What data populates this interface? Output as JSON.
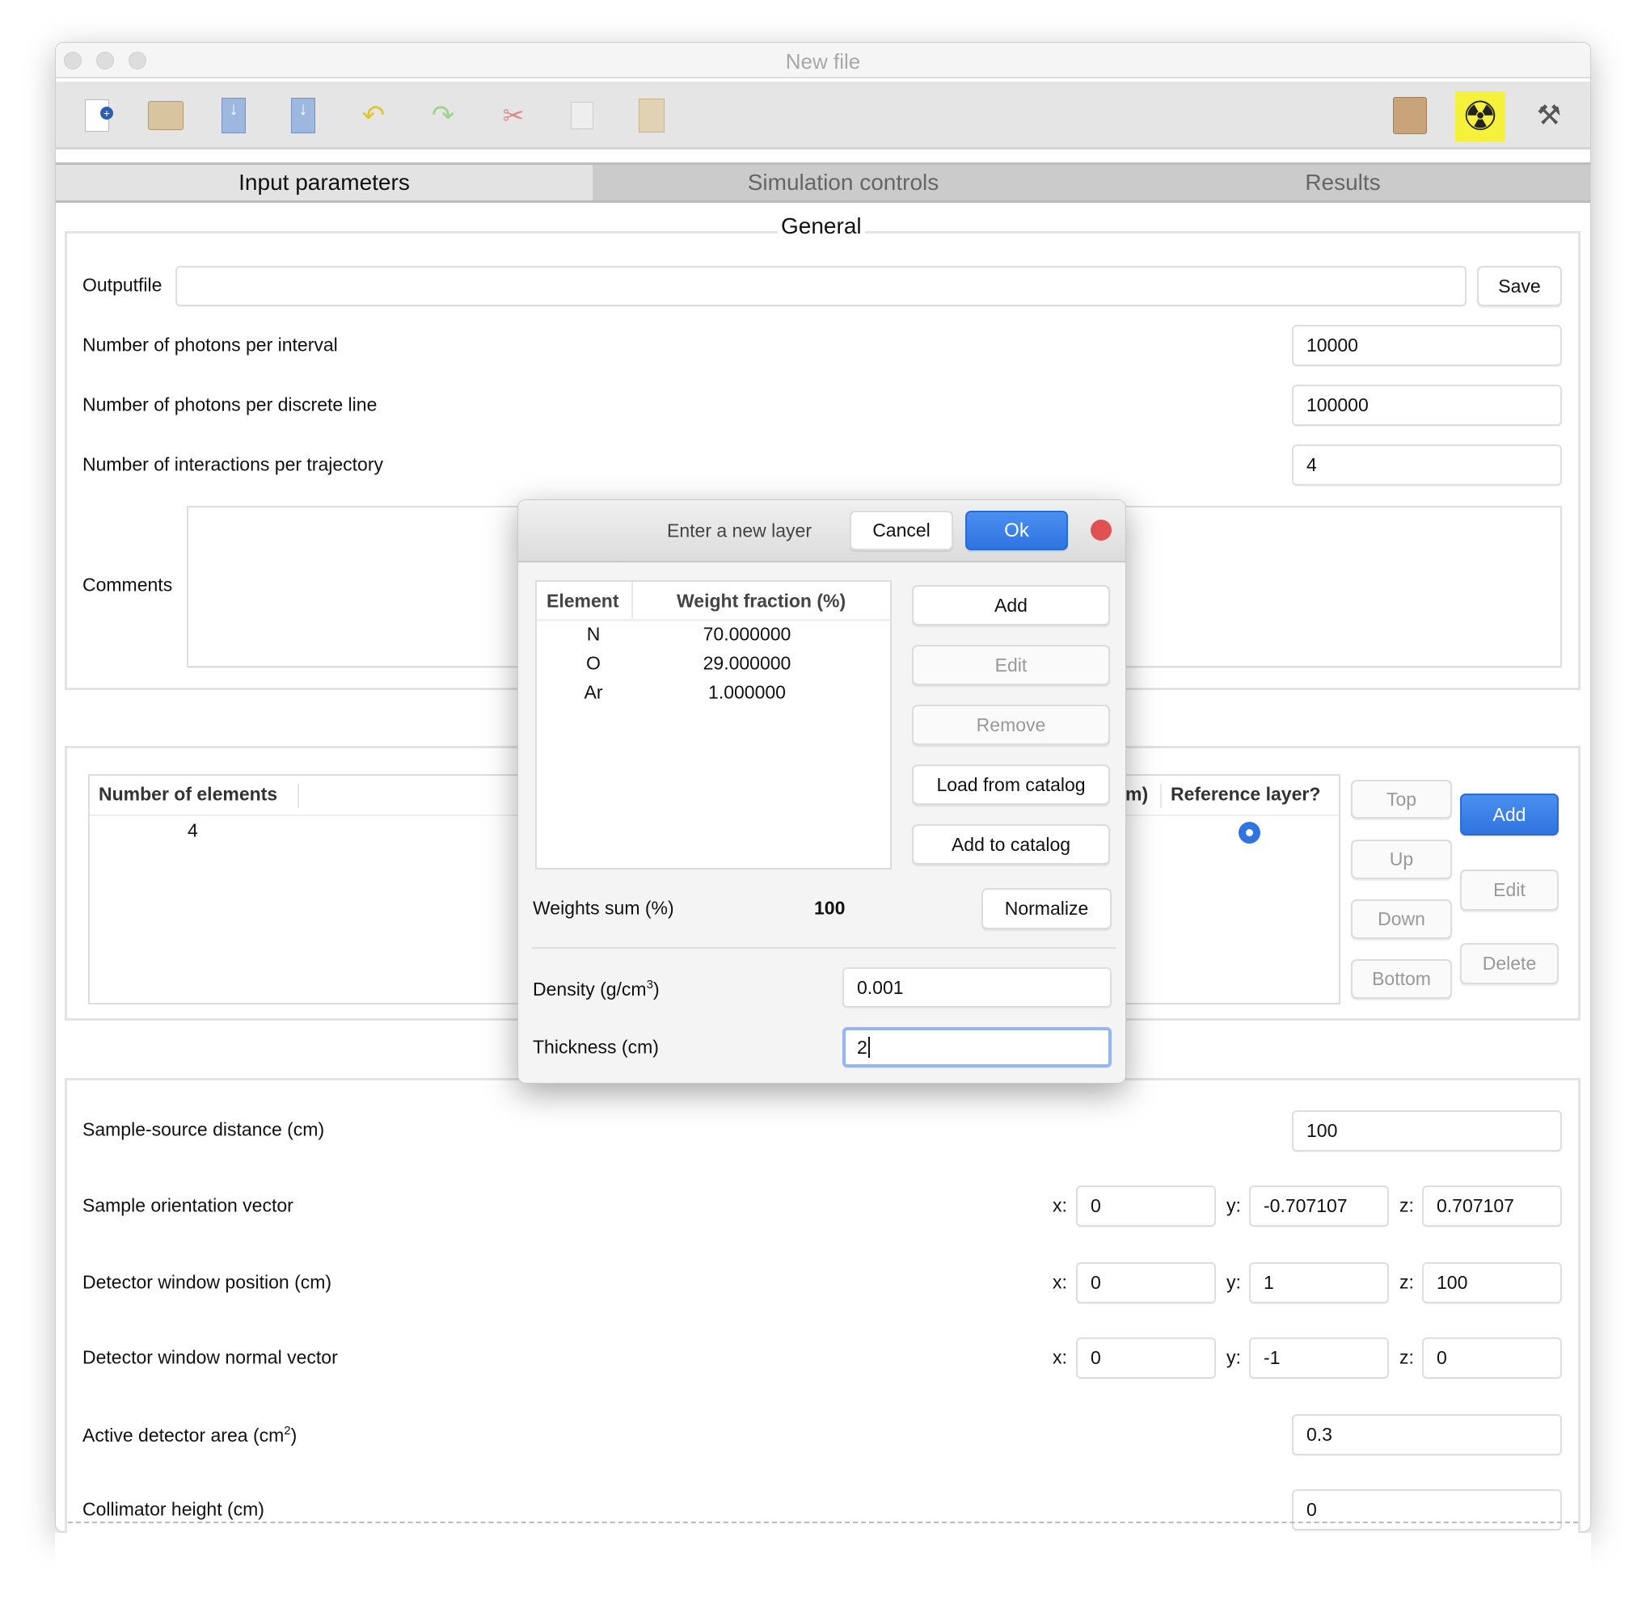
{
  "window": {
    "title": "New file"
  },
  "toolbar": {
    "icons": [
      "new-file-icon",
      "open-folder-icon",
      "save-icon",
      "save-as-icon",
      "undo-icon",
      "redo-icon",
      "cut-icon",
      "copy-icon",
      "paste-icon",
      "package-icon",
      "radiation-icon",
      "tools-icon"
    ]
  },
  "tabs": [
    {
      "label": "Input parameters",
      "active": true
    },
    {
      "label": "Simulation controls",
      "active": false
    },
    {
      "label": "Results",
      "active": false
    }
  ],
  "general": {
    "title": "General",
    "outputfile_label": "Outputfile",
    "outputfile_value": "",
    "save_label": "Save",
    "photons_interval_label": "Number of photons per interval",
    "photons_interval_value": "10000",
    "photons_line_label": "Number of photons per discrete line",
    "photons_line_value": "100000",
    "interactions_label": "Number of interactions per trajectory",
    "interactions_value": "4",
    "comments_label": "Comments",
    "comments_value": ""
  },
  "layers": {
    "columns": {
      "number_of_elements": "Number of elements",
      "thickness_partial": "m)",
      "reference": "Reference layer?"
    },
    "rows": [
      {
        "number_of_elements": "4",
        "reference": true
      }
    ],
    "buttons": {
      "top": "Top",
      "up": "Up",
      "down": "Down",
      "bottom": "Bottom",
      "add": "Add",
      "edit": "Edit",
      "delete": "Delete"
    }
  },
  "geometry": {
    "distance_label": "Sample-source distance (cm)",
    "distance_value": "100",
    "orientation_label": "Sample orientation vector",
    "orientation": {
      "x": "0",
      "y": "-0.707107",
      "z": "0.707107"
    },
    "det_pos_label": "Detector window position (cm)",
    "det_pos": {
      "x": "0",
      "y": "1",
      "z": "100"
    },
    "det_normal_label": "Detector window normal vector",
    "det_normal": {
      "x": "0",
      "y": "-1",
      "z": "0"
    },
    "area_label": "Active detector area (cm",
    "area_sup": "2",
    "area_close": ")",
    "area_value": "0.3",
    "collimator_label": "Collimator height (cm)",
    "collimator_value": "0",
    "x_label": "x:",
    "y_label": "y:",
    "z_label": "z:"
  },
  "dialog": {
    "title": "Enter a new layer",
    "cancel": "Cancel",
    "ok": "Ok",
    "table": {
      "headers": [
        "Element",
        "Weight fraction (%)"
      ],
      "rows": [
        [
          "N",
          "70.000000"
        ],
        [
          "O",
          "29.000000"
        ],
        [
          "Ar",
          "1.000000"
        ]
      ]
    },
    "buttons": {
      "add": "Add",
      "edit": "Edit",
      "remove": "Remove",
      "load": "Load from catalog",
      "add_catalog": "Add to catalog",
      "normalize": "Normalize"
    },
    "weights_sum_label": "Weights sum (%)",
    "weights_sum_value": "100",
    "density_label": "Density (g/cm",
    "density_sup": "3",
    "density_close": ")",
    "density_value": "0.001",
    "thickness_label": "Thickness (cm)",
    "thickness_value": "2"
  },
  "colors": {
    "accent": "#2f74e0",
    "close": "#e05252",
    "focus": "#93b6f5",
    "radiation_bg": "#f6f13a"
  }
}
